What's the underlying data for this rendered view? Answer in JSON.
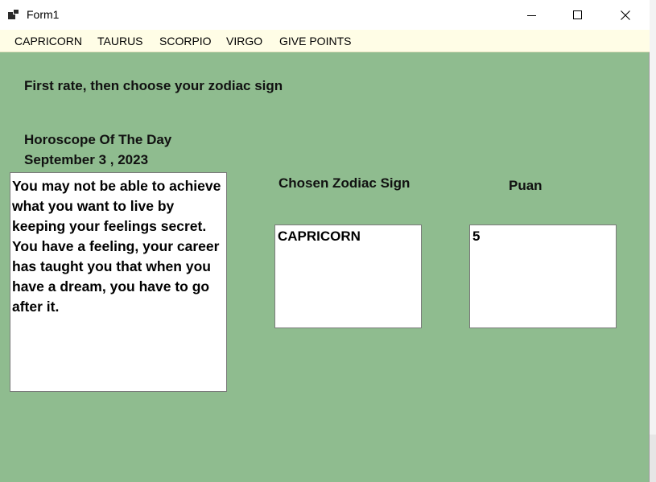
{
  "window": {
    "title": "Form1",
    "controls": {
      "minimize": "minimize-icon",
      "maximize": "maximize-icon",
      "close": "close-icon"
    }
  },
  "menu": {
    "items": [
      "CAPRICORN",
      "TAURUS",
      "SCORPIO",
      "VIRGO",
      "GIVE POINTS"
    ]
  },
  "main": {
    "instruction": "First rate, then choose your zodiac sign",
    "horoscope_heading": "Horoscope Of The Day",
    "date": "September 3 ,  2023",
    "horoscope_text": "You may not be able to achieve what you want to live by keeping your feelings secret. You have a feeling, your career has taught you that when you have a dream, you have to go after it.",
    "chosen_sign_label": "Chosen Zodiac Sign",
    "chosen_sign_value": "CAPRICORN",
    "points_label": "Puan",
    "points_value": "5"
  },
  "colors": {
    "form_background": "#8fbc8f",
    "menu_background": "#fffde6",
    "titlebar_background": "#ffffff"
  }
}
